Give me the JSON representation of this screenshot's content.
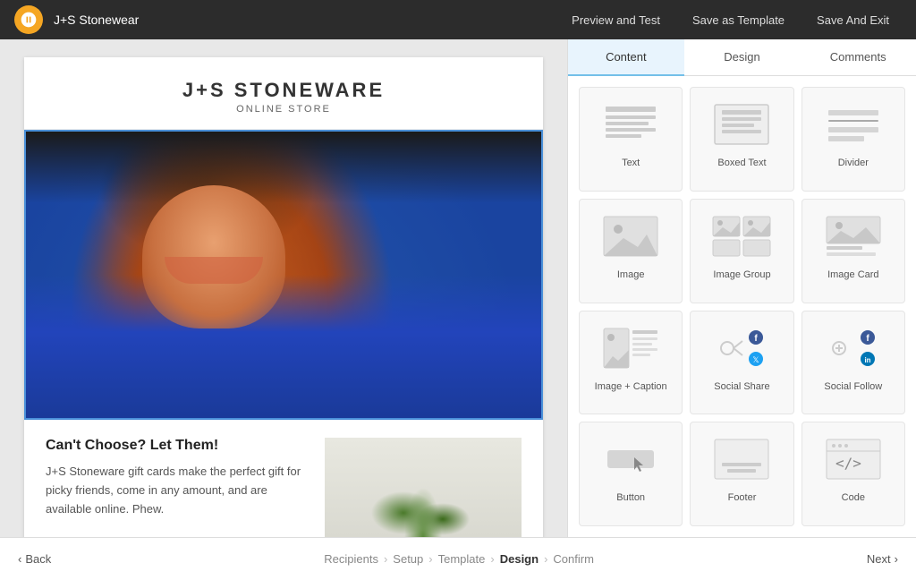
{
  "topNav": {
    "brand": "J+S Stonewear",
    "previewBtn": "Preview and Test",
    "saveTemplateBtn": "Save as Template",
    "saveExitBtn": "Save And Exit"
  },
  "email": {
    "brandName": "J+S STONEWARE",
    "brandSub": "ONLINE STORE",
    "contentHeadline": "Can't Choose? Let Them!",
    "contentBody": "J+S Stoneware gift cards make the perfect gift for picky friends, come in any amount, and are available online. Phew."
  },
  "rightPanel": {
    "tabs": [
      {
        "id": "content",
        "label": "Content",
        "active": true
      },
      {
        "id": "design",
        "label": "Design",
        "active": false
      },
      {
        "id": "comments",
        "label": "Comments",
        "active": false
      }
    ],
    "blocks": [
      {
        "id": "text",
        "label": "Text"
      },
      {
        "id": "boxed-text",
        "label": "Boxed Text"
      },
      {
        "id": "divider",
        "label": "Divider"
      },
      {
        "id": "image",
        "label": "Image"
      },
      {
        "id": "image-group",
        "label": "Image Group"
      },
      {
        "id": "image-card",
        "label": "Image Card"
      },
      {
        "id": "image-caption",
        "label": "Image + Caption"
      },
      {
        "id": "social-share",
        "label": "Social Share"
      },
      {
        "id": "social-follow",
        "label": "Social Follow"
      },
      {
        "id": "button",
        "label": "Button"
      },
      {
        "id": "footer",
        "label": "Footer"
      },
      {
        "id": "code",
        "label": "Code"
      }
    ]
  },
  "bottomNav": {
    "backLabel": "Back",
    "nextLabel": "Next",
    "breadcrumbs": [
      {
        "label": "Recipients",
        "active": false
      },
      {
        "label": "Setup",
        "active": false
      },
      {
        "label": "Template",
        "active": false
      },
      {
        "label": "Design",
        "active": true
      },
      {
        "label": "Confirm",
        "active": false
      }
    ]
  }
}
